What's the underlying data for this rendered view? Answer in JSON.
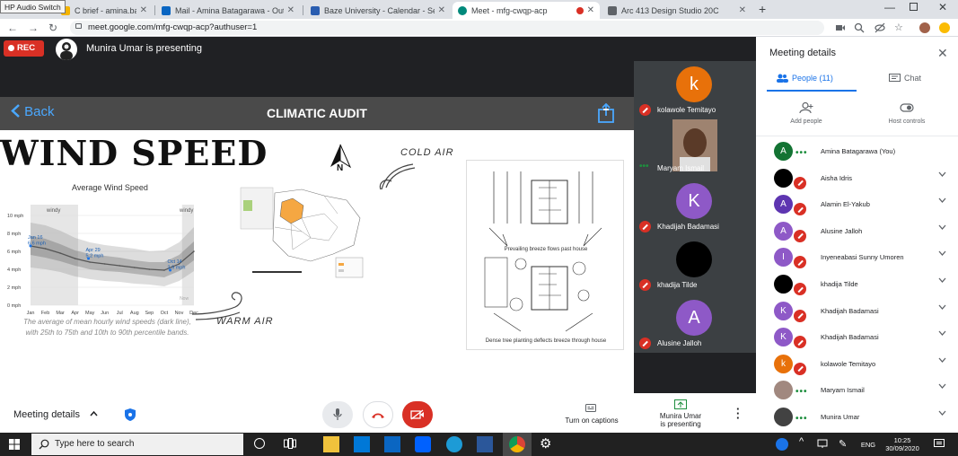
{
  "browser": {
    "tooltip": "HP Audio Switch",
    "tabs": [
      {
        "title": "C brief - amina.bataga",
        "color": "#f4b400"
      },
      {
        "title": "Mail - Amina Batagarawa - Outlo",
        "color": "#0a66c2"
      },
      {
        "title": "Baze University - Calendar - Sept",
        "color": "#2a5db0"
      },
      {
        "title": "Meet - mfg-cwqp-acp",
        "color": "#00897b"
      },
      {
        "title": "Arc 413 Design Studio 20C",
        "color": "#5f6368"
      }
    ],
    "url": "meet.google.com/mfg-cwqp-acp?authuser=1"
  },
  "meeting": {
    "rec_label": "REC",
    "presenting_text": "Munira Umar is presenting"
  },
  "slide": {
    "back_label": "Back",
    "title": "CLIMATIC AUDIT",
    "heading": "WIND SPEED",
    "north_label": "N",
    "cold_air": "COLD AIR",
    "warm_air": "WARM AIR",
    "chart_title": "Average Wind Speed",
    "chart_caption": "The average of mean hourly wind speeds (dark line), with 25th to 75th and 10th to 90th percentile bands.",
    "plan_caption_1": "Prevailing breeze flows past house",
    "plan_caption_2": "Dense tree planting deflects breeze through house"
  },
  "chart_data": {
    "type": "line",
    "title": "Average Wind Speed",
    "categories": [
      "Jan",
      "Feb",
      "Mar",
      "Apr",
      "May",
      "Jun",
      "Jul",
      "Aug",
      "Sep",
      "Oct",
      "Nov",
      "Dec"
    ],
    "series": [
      {
        "values": [
          6.6,
          6.3,
          5.8,
          5.2,
          4.8,
          4.6,
          4.4,
          4.2,
          4.0,
          3.9,
          4.6,
          6.0
        ]
      }
    ],
    "band_25_75_low": [
      5.6,
      5.3,
      4.9,
      4.4,
      4.0,
      3.8,
      3.7,
      3.5,
      3.3,
      3.1,
      3.8,
      5.0
    ],
    "band_25_75_high": [
      7.7,
      7.4,
      6.8,
      6.1,
      5.7,
      5.5,
      5.3,
      5.0,
      4.8,
      4.8,
      5.6,
      7.1
    ],
    "band_10_90_low": [
      4.2,
      4.0,
      3.7,
      3.2,
      2.9,
      2.7,
      2.6,
      2.4,
      2.3,
      2.1,
      2.7,
      3.8
    ],
    "band_10_90_high": [
      9.2,
      8.9,
      8.3,
      7.5,
      7.0,
      6.7,
      6.5,
      6.3,
      6.0,
      6.1,
      7.0,
      8.7
    ],
    "ylim": [
      0,
      10
    ],
    "yticks": [
      "0 mph",
      "2 mph",
      "4 mph",
      "6 mph",
      "8 mph",
      "10 mph"
    ],
    "annotations": [
      {
        "label": "Jan 16",
        "value_label": "6.6 mph",
        "index": 0,
        "value": 6.6
      },
      {
        "label": "Apr 29",
        "value_label": "5.2 mph",
        "index": 3.9,
        "value": 5.2
      },
      {
        "label": "Oct 14",
        "value_label": "3.9 mph",
        "index": 9.4,
        "value": 3.9
      }
    ],
    "windy_label": "windy",
    "now_label": "Now"
  },
  "tiles": [
    {
      "name": "kolawole Temitayo",
      "initial": "k",
      "color": "#e8710a"
    },
    {
      "name": "Maryam Ismail",
      "initial": "",
      "color": "#8d6e63"
    },
    {
      "name": "Khadijah Badamasi",
      "initial": "K",
      "color": "#8e59c7"
    },
    {
      "name": "khadija Tilde",
      "initial": "",
      "color": "#000000"
    },
    {
      "name": "Alusine Jalloh",
      "initial": "A",
      "color": "#8e59c7"
    }
  ],
  "panel": {
    "title": "Meeting details",
    "people_tab": "People (11)",
    "chat_tab": "Chat",
    "add_people": "Add people",
    "host_controls": "Host controls",
    "participants": [
      {
        "name": "Amina Batagarawa (You)",
        "initial": "A",
        "color": "#137333",
        "muted": false
      },
      {
        "name": "Aisha Idris",
        "initial": "",
        "color": "#000000",
        "muted": true
      },
      {
        "name": "Alamin El-Yakub",
        "initial": "A",
        "color": "#5e35b1",
        "muted": true
      },
      {
        "name": "Alusine Jalloh",
        "initial": "A",
        "color": "#8e59c7",
        "muted": true
      },
      {
        "name": "Inyeneabasi Sunny Umoren",
        "initial": "I",
        "color": "#8e59c7",
        "muted": true
      },
      {
        "name": "khadija Tilde",
        "initial": "",
        "color": "#000000",
        "muted": true
      },
      {
        "name": "Khadijah Badamasi",
        "initial": "K",
        "color": "#8e59c7",
        "muted": true
      },
      {
        "name": "Khadijah Badamasi",
        "initial": "K",
        "color": "#8e59c7",
        "muted": true
      },
      {
        "name": "kolawole Temitayo",
        "initial": "k",
        "color": "#e8710a",
        "muted": true
      },
      {
        "name": "Maryam Ismail",
        "initial": "",
        "color": "#a1887f",
        "muted": false
      },
      {
        "name": "Munira Umar",
        "initial": "",
        "color": "#424242",
        "muted": false
      }
    ]
  },
  "bottombar": {
    "meeting_details": "Meeting details",
    "captions_label": "Turn on captions",
    "presenting_line1": "Munira Umar",
    "presenting_line2": "is presenting"
  },
  "taskbar": {
    "search_placeholder": "Type here to search",
    "language": "ENG",
    "time": "10:25",
    "date": "30/09/2020"
  }
}
